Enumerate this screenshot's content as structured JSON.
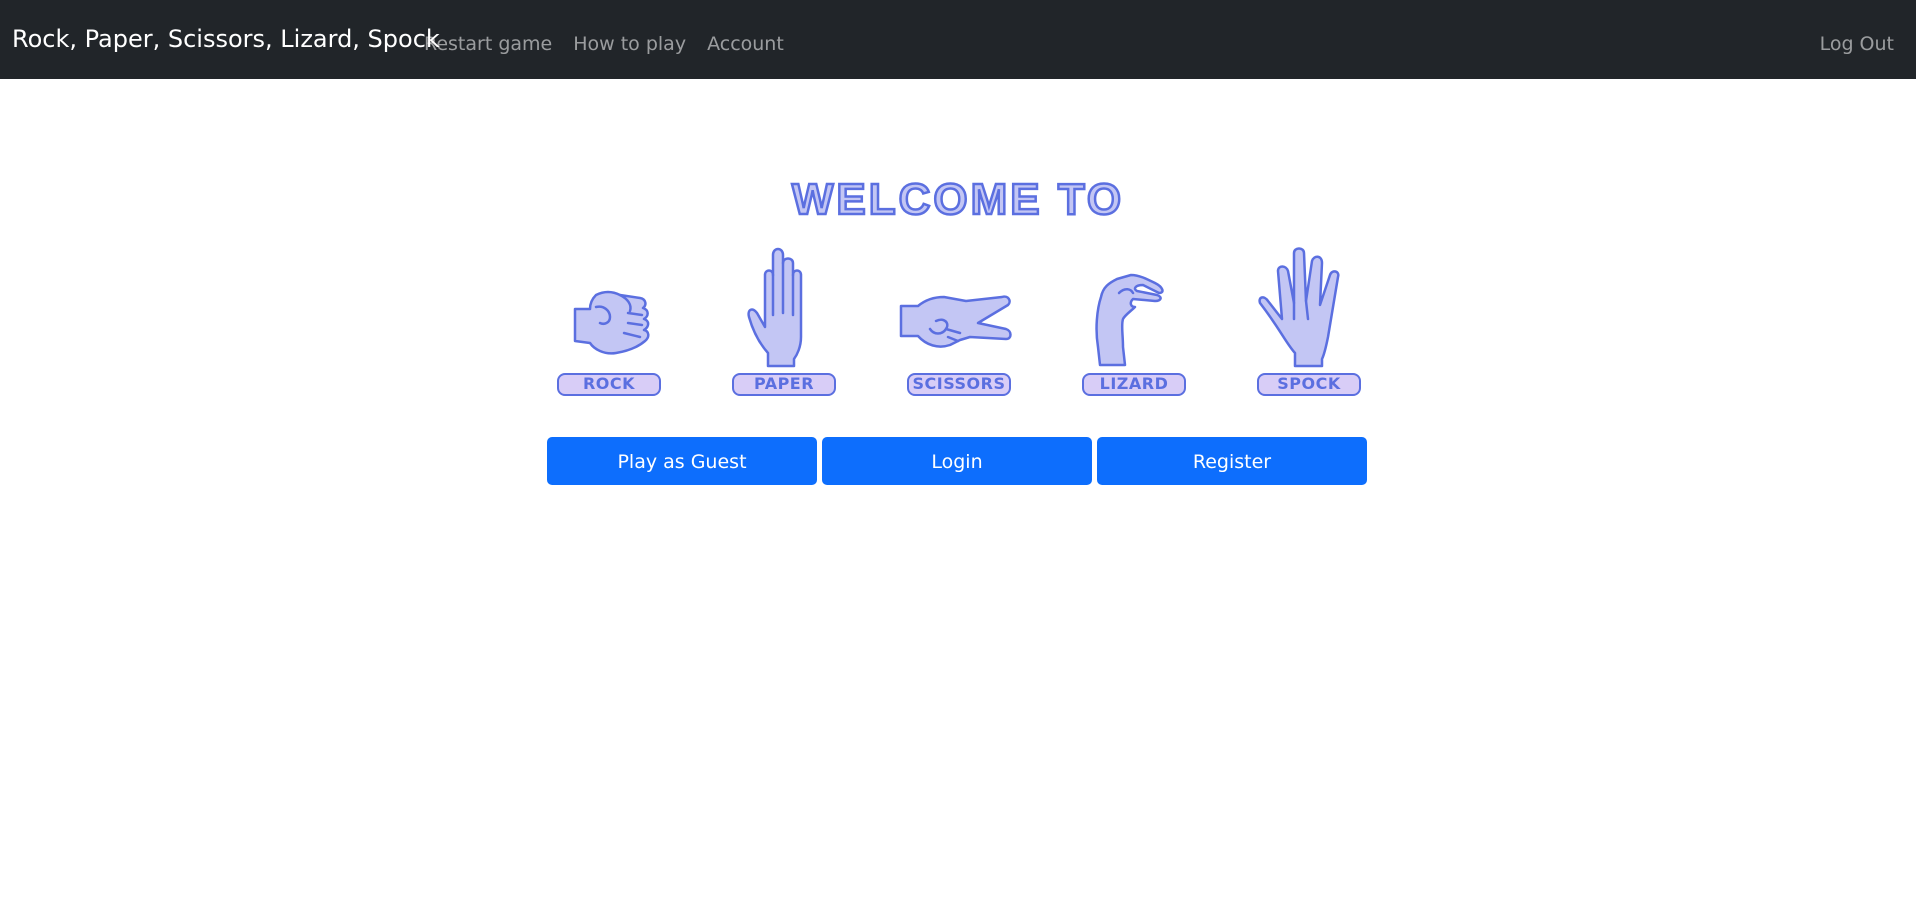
{
  "navbar": {
    "brand": "Rock, Paper, Scissors, Lizard, Spock",
    "links": [
      "Restart game",
      "How to play",
      "Account"
    ],
    "logout": "Log Out",
    "background_color": "#212529"
  },
  "hero": {
    "welcome_text": "WELCOME TO",
    "hands": [
      {
        "label": "ROCK",
        "icon": "rock-hand-icon"
      },
      {
        "label": "PAPER",
        "icon": "paper-hand-icon"
      },
      {
        "label": "SCISSORS",
        "icon": "scissors-hand-icon"
      },
      {
        "label": "LIZARD",
        "icon": "lizard-hand-icon"
      },
      {
        "label": "SPOCK",
        "icon": "spock-hand-icon"
      }
    ],
    "colors": {
      "outline": "#5b6fe0",
      "fill": "#c3c6f4",
      "label_fill": "#d8cdf7"
    }
  },
  "actions": {
    "guest": "Play as Guest",
    "login": "Login",
    "register": "Register",
    "button_color": "#0d6efd"
  }
}
